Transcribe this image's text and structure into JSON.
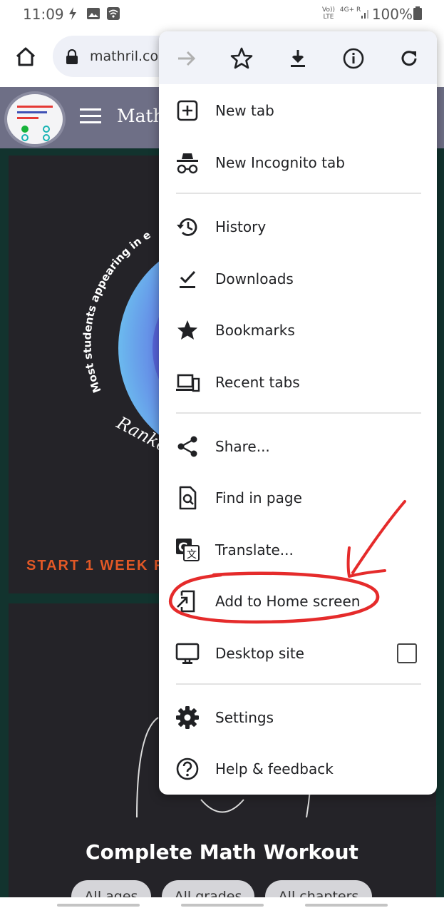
{
  "status_bar": {
    "time": "11:09",
    "battery": "100%",
    "volte": "Vo)) LTE",
    "network": "4G+",
    "roaming": "R"
  },
  "toolbar": {
    "url": "mathril.com"
  },
  "site": {
    "title": "Math",
    "promo": "START 1 WEEK F",
    "circle_text_1": "Most students appearing in e",
    "circle_text_2": "Ranke",
    "section_title": "Complete Math Workout",
    "chips": [
      "All ages",
      "All grades",
      "All chapters"
    ]
  },
  "menu": {
    "top_icons": [
      "forward-icon",
      "star-outline-icon",
      "download-icon",
      "info-icon",
      "refresh-icon"
    ],
    "items": [
      {
        "label": "New tab",
        "icon": "new-tab-icon"
      },
      {
        "label": "New Incognito tab",
        "icon": "incognito-icon"
      },
      {
        "label": "History",
        "icon": "history-icon"
      },
      {
        "label": "Downloads",
        "icon": "downloads-check-icon"
      },
      {
        "label": "Bookmarks",
        "icon": "star-filled-icon"
      },
      {
        "label": "Recent tabs",
        "icon": "devices-icon"
      },
      {
        "label": "Share...",
        "icon": "share-icon"
      },
      {
        "label": "Find in page",
        "icon": "find-in-page-icon"
      },
      {
        "label": "Translate...",
        "icon": "translate-icon"
      },
      {
        "label": "Add to Home screen",
        "icon": "add-to-home-icon"
      },
      {
        "label": "Desktop site",
        "icon": "desktop-icon"
      },
      {
        "label": "Settings",
        "icon": "gear-icon"
      },
      {
        "label": "Help & feedback",
        "icon": "help-icon"
      }
    ],
    "desktop_site_checked": false
  },
  "annotation": {
    "color": "#e52b2b",
    "highlighted_item": "Add to Home screen"
  }
}
